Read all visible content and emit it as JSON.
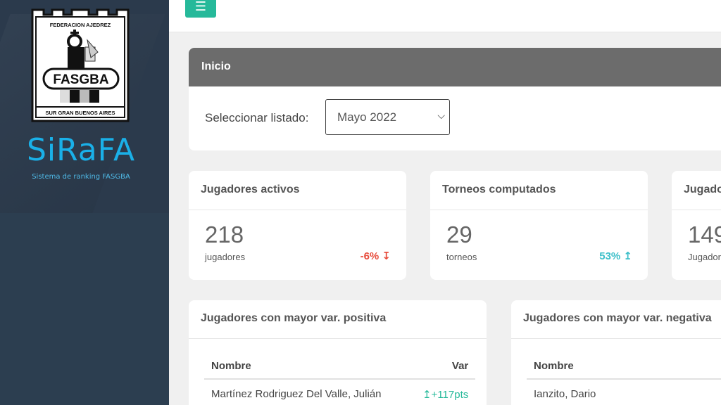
{
  "sidebar": {
    "logo_top": "FEDERACION AJEDREZ",
    "logo_name": "FASGBA",
    "logo_bottom": "SUR GRAN BUENOS AIRES",
    "brand": "SiRaFA",
    "brand_sub": "Sistema de ranking FASGBA"
  },
  "topbar": {
    "menu_icon": "☰"
  },
  "inicio": {
    "title": "Inicio",
    "select_label": "Seleccionar listado:",
    "select_value": "Mayo 2022",
    "chevron": "⌵"
  },
  "cards": [
    {
      "title": "Jugadores activos",
      "value": "218",
      "unit": "jugadores",
      "variation": "-6% ↧"
    },
    {
      "title": "Torneos computados",
      "value": "29",
      "unit": "torneos",
      "variation": "53% ↥"
    },
    {
      "title": "Jugado",
      "value": "149",
      "unit": "Jugador"
    }
  ],
  "positive": {
    "title": "Jugadores con mayor var. positiva",
    "col_name": "Nombre",
    "col_var": "Var",
    "rows": [
      {
        "name": "Martínez Rodriguez Del Valle, Julián",
        "var": "↥+117pts"
      }
    ]
  },
  "negative": {
    "title": "Jugadores con mayor var. negativa",
    "col_name": "Nombre",
    "rows": [
      {
        "name": "Ianzito, Dario"
      }
    ]
  },
  "colors": {
    "sidebar": "#2c3e50",
    "accent": "#26b99a",
    "brand": "#1ab0e8",
    "negative": "#e74c3c",
    "positive": "#3dbfc9"
  }
}
